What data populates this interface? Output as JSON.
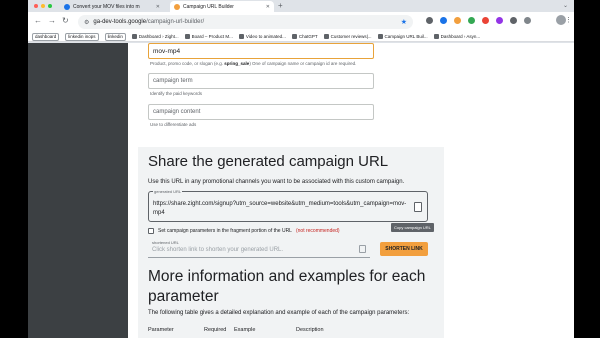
{
  "browser": {
    "tabs": [
      {
        "title": "Convert your MOV files into m",
        "favicon_color": "#1a73e8"
      },
      {
        "title": "Campaign URL Builder",
        "favicon_color": "#f29f3e"
      }
    ],
    "new_tab": "+",
    "url_host": "ga-dev-tools.google",
    "url_path": "/campaign-url-builder/",
    "bookmarks": {
      "chips": [
        "dashboard",
        "linkedin inops",
        "linkedin"
      ],
      "items": [
        "Dashboard › Zight...",
        "Board – Product M...",
        "Video to animated...",
        "ChatGPT",
        "Customer reviews|...",
        "Campaign URL Buil...",
        "Dashboard › Asyn..."
      ]
    }
  },
  "form": {
    "campaign_name_value": "mov-mp4",
    "campaign_name_hint_prefix": "Product, promo code, or slogan (e.g. ",
    "campaign_name_hint_bold": "spring_sale",
    "campaign_name_hint_suffix": ") One of campaign name or campaign id are required.",
    "campaign_term_placeholder": "campaign term",
    "campaign_term_hint": "Identify the paid keywords",
    "campaign_content_placeholder": "campaign content",
    "campaign_content_hint": "Use to differentiate ads"
  },
  "share": {
    "title": "Share the generated campaign URL",
    "description": "Use this URL in any promotional channels you want to be associated with this custom campaign.",
    "url_label": "generated URL",
    "url_value": "https://share.zight.com/signup?utm_source=website&utm_medium=tools&utm_campaign=mov-mp4",
    "copy_tooltip": "Copy campaign URL",
    "checkbox_label": "Set campaign parameters in the fragment portion of the URL",
    "checkbox_warning": "(not recommended)",
    "shortened_label": "shortened URL",
    "shortened_placeholder": "Click shorten link to shorten your generated URL.",
    "shorten_button": "SHORTEN LINK"
  },
  "more_info": {
    "title": "More information and examples for each parameter",
    "description": "The following table gives a detailed explanation and example of each of the campaign parameters:",
    "columns": [
      "Parameter",
      "Required",
      "Example",
      "Description"
    ]
  }
}
